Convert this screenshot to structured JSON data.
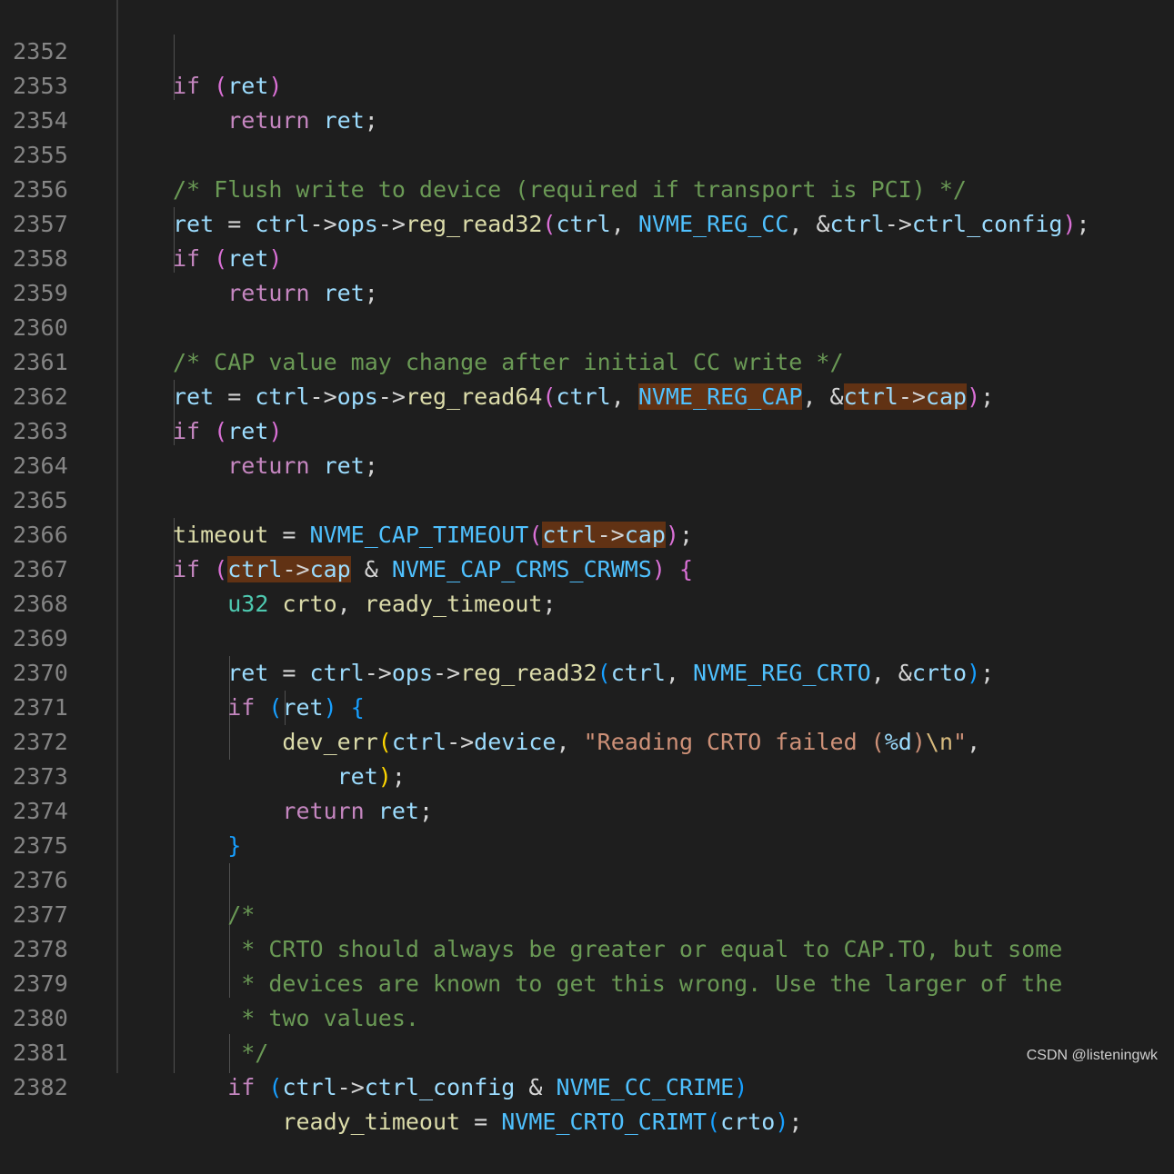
{
  "editor": {
    "line_numbers": [
      "2352",
      "2353",
      "2354",
      "2355",
      "2356",
      "2357",
      "2358",
      "2359",
      "2360",
      "2361",
      "2362",
      "2363",
      "2364",
      "2365",
      "2366",
      "2367",
      "2368",
      "2369",
      "2370",
      "2371",
      "2372",
      "2373",
      "2374",
      "2375",
      "2376",
      "2377",
      "2378",
      "2379",
      "2380",
      "2381",
      "2382"
    ],
    "colors": {
      "background": "#1e1e1e",
      "keyword": "#c586c0",
      "variable": "#9cdcfe",
      "function": "#dcdcaa",
      "macro": "#4fc1ff",
      "comment": "#6a9955",
      "type": "#4ec9b0",
      "string": "#ce9178",
      "highlight": "#613214"
    }
  },
  "watermark": "CSDN @listeningwk"
}
